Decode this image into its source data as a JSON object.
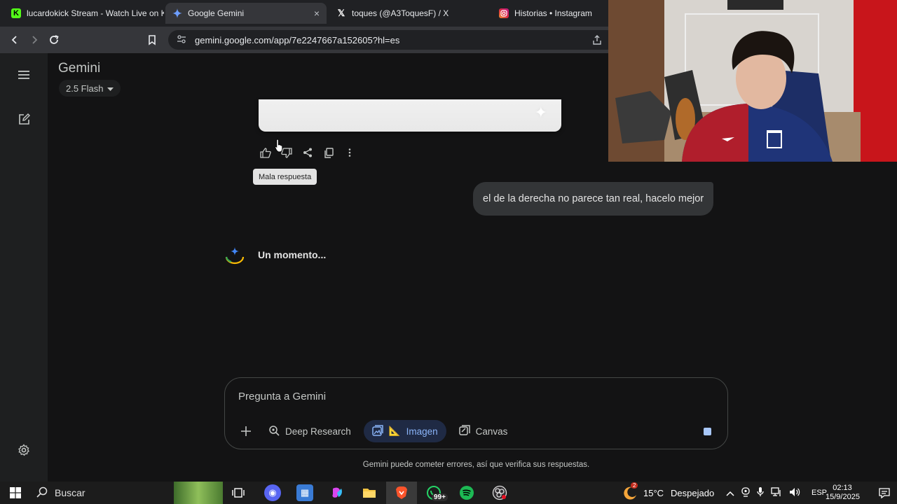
{
  "browser": {
    "tabs": [
      {
        "title": "lucardokick Stream - Watch Live on K",
        "favicon": "kick-icon",
        "color": "#53fc18",
        "active": false
      },
      {
        "title": "Google Gemini",
        "favicon": "gemini-icon",
        "color": "#4285f4",
        "active": true,
        "close": "×"
      },
      {
        "title": "toques (@A3ToquesF) / X",
        "favicon": "x-icon",
        "color": "#ffffff",
        "active": false
      },
      {
        "title": "Historias • Instagram",
        "favicon": "instagram-icon",
        "color": "#e1306c",
        "active": false
      }
    ],
    "url": "gemini.google.com/app/7e2247667a152605?hl=es"
  },
  "app": {
    "title": "Gemini",
    "model": "2.5 Flash"
  },
  "chat": {
    "tooltip": "Mala respuesta",
    "user_message": "el de la derecha no parece tan real, hacelo mejor",
    "loading_text": "Un momento..."
  },
  "composer": {
    "placeholder": "Pregunta a Gemini",
    "tools": {
      "deep_research": "Deep Research",
      "image": "Imagen",
      "image_emoji": "📐",
      "canvas": "Canvas"
    }
  },
  "footer": {
    "disclaimer": "Gemini puede cometer errores, así que verifica sus respuestas."
  },
  "taskbar": {
    "search_label": "Buscar",
    "whatsapp_badge": "99+",
    "weather_badge": "2",
    "weather": "15°C",
    "weather_desc": "Despejado",
    "language": "ESP",
    "time": "02:13",
    "date": "15/9/2025"
  },
  "colors": {
    "accent": "#8ab4f8",
    "background": "#131314"
  }
}
